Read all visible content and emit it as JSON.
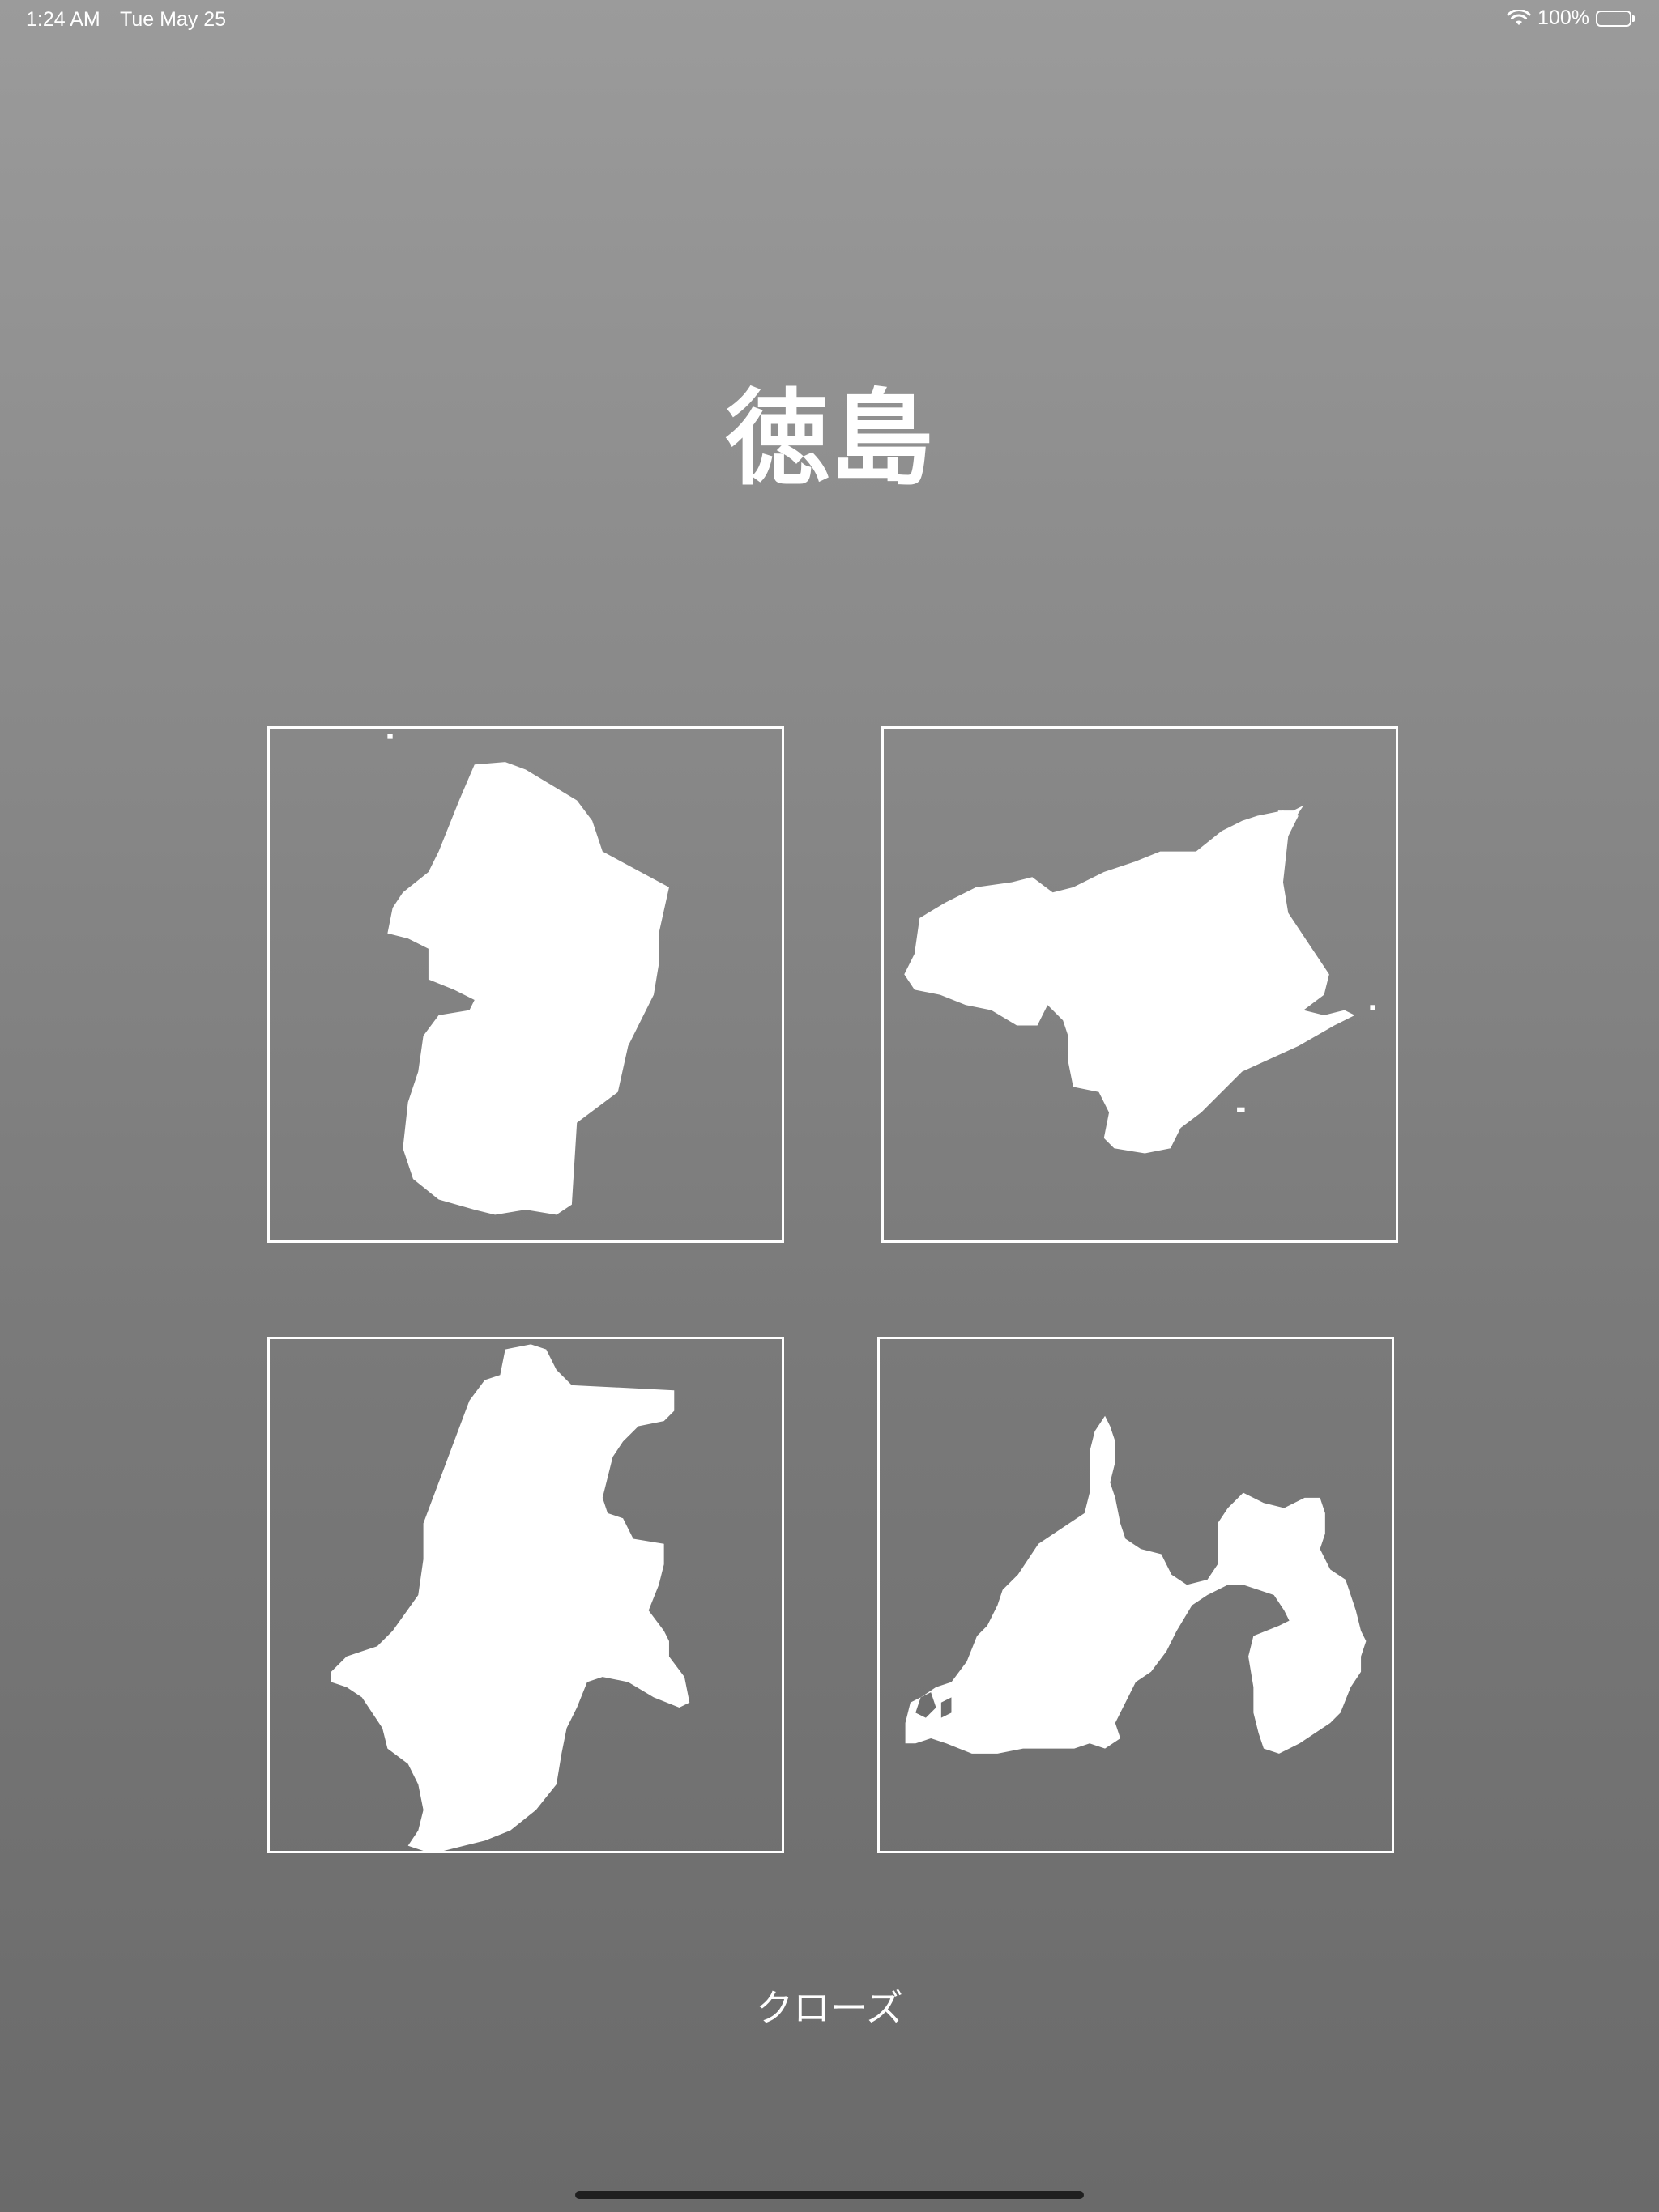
{
  "status_bar": {
    "time": "1:24 AM",
    "date": "Tue May 25",
    "battery_percent": "100%",
    "battery_level": 1.0,
    "icons": [
      "wifi-icon",
      "battery-icon"
    ]
  },
  "quiz": {
    "title": "徳島",
    "choices": [
      {
        "icon": "prefecture-silhouette-icon"
      },
      {
        "icon": "prefecture-silhouette-icon"
      },
      {
        "icon": "prefecture-silhouette-icon"
      },
      {
        "icon": "prefecture-silhouette-icon"
      }
    ],
    "close_label": "クローズ"
  },
  "colors": {
    "background_top": "#9b9b9b",
    "background_bottom": "#6a6a6a",
    "foreground": "#ffffff",
    "home_indicator": "#1f1f1f"
  }
}
